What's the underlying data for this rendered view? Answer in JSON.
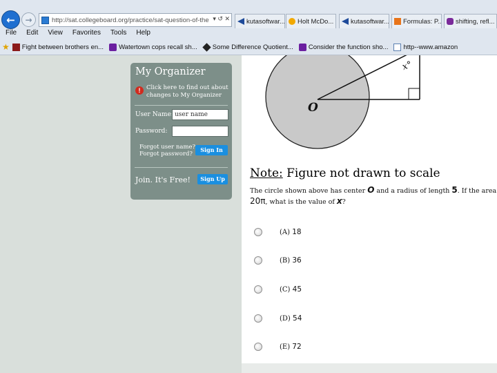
{
  "browser": {
    "url": "http://sat.collegeboard.org/practice/sat-question-of-the",
    "address_tail": "▾ ↺ ✕",
    "tabs": [
      {
        "label": "kutasoftwar...",
        "icon_color": "#1f4b9a"
      },
      {
        "label": "Holt McDo...",
        "icon_color": "#f2a900"
      },
      {
        "label": "kutasoftwar...",
        "icon_color": "#1f4b9a"
      },
      {
        "label": "Formulas: P...",
        "icon_color": "#e8741a"
      },
      {
        "label": "shifting, refl...",
        "icon_color": "#7a2a9a"
      }
    ],
    "menu": [
      "File",
      "Edit",
      "View",
      "Favorites",
      "Tools",
      "Help"
    ],
    "favorites": [
      {
        "label": "Fight between brothers en...",
        "icon": "news-icon",
        "icon_color": "#8b1a1a"
      },
      {
        "label": "Watertown cops recall sh...",
        "icon": "yahoo-icon",
        "icon_color": "#6b1fa0"
      },
      {
        "label": "Some Difference Quotient...",
        "icon": "diamond-icon",
        "icon_color": "#222222"
      },
      {
        "label": "Consider the function sho...",
        "icon": "yahoo-icon",
        "icon_color": "#6b1fa0"
      },
      {
        "label": "http--www.amazon",
        "icon": "page-icon",
        "icon_color": "#5a7fb0"
      }
    ]
  },
  "organizer": {
    "title": "My Organizer",
    "alert_link": "Click here to find out about changes to My Organizer",
    "user_label": "User Name:",
    "user_value": "user name",
    "password_label": "Password:",
    "forgot_user": "Forgot user name?",
    "forgot_password": "Forgot password?",
    "signin_label": "Sign In",
    "join_label": "Join. It's Free!",
    "signup_label": "Sign Up",
    "bg_color": "#7d8f89",
    "button_color": "#1a8fe0"
  },
  "question": {
    "figure_center_label": "O",
    "figure_angle_label": "x°",
    "note_prefix": "Note:",
    "note_text": " Figure not drawn to scale",
    "text_line1_a": "The circle shown above has center ",
    "text_line1_center": "O",
    "text_line1_b": " and a radius of length ",
    "text_line1_radius": "5",
    "text_line1_c": ". If the area of t",
    "text_line2_value": "20π",
    "text_line2_a": ", what is the value of ",
    "text_line2_var": "x",
    "text_line2_b": "?",
    "choices": [
      {
        "letter": "(A)",
        "value": "18"
      },
      {
        "letter": "(B)",
        "value": "36"
      },
      {
        "letter": "(C)",
        "value": "45"
      },
      {
        "letter": "(D)",
        "value": "54"
      },
      {
        "letter": "(E)",
        "value": "72"
      }
    ]
  }
}
